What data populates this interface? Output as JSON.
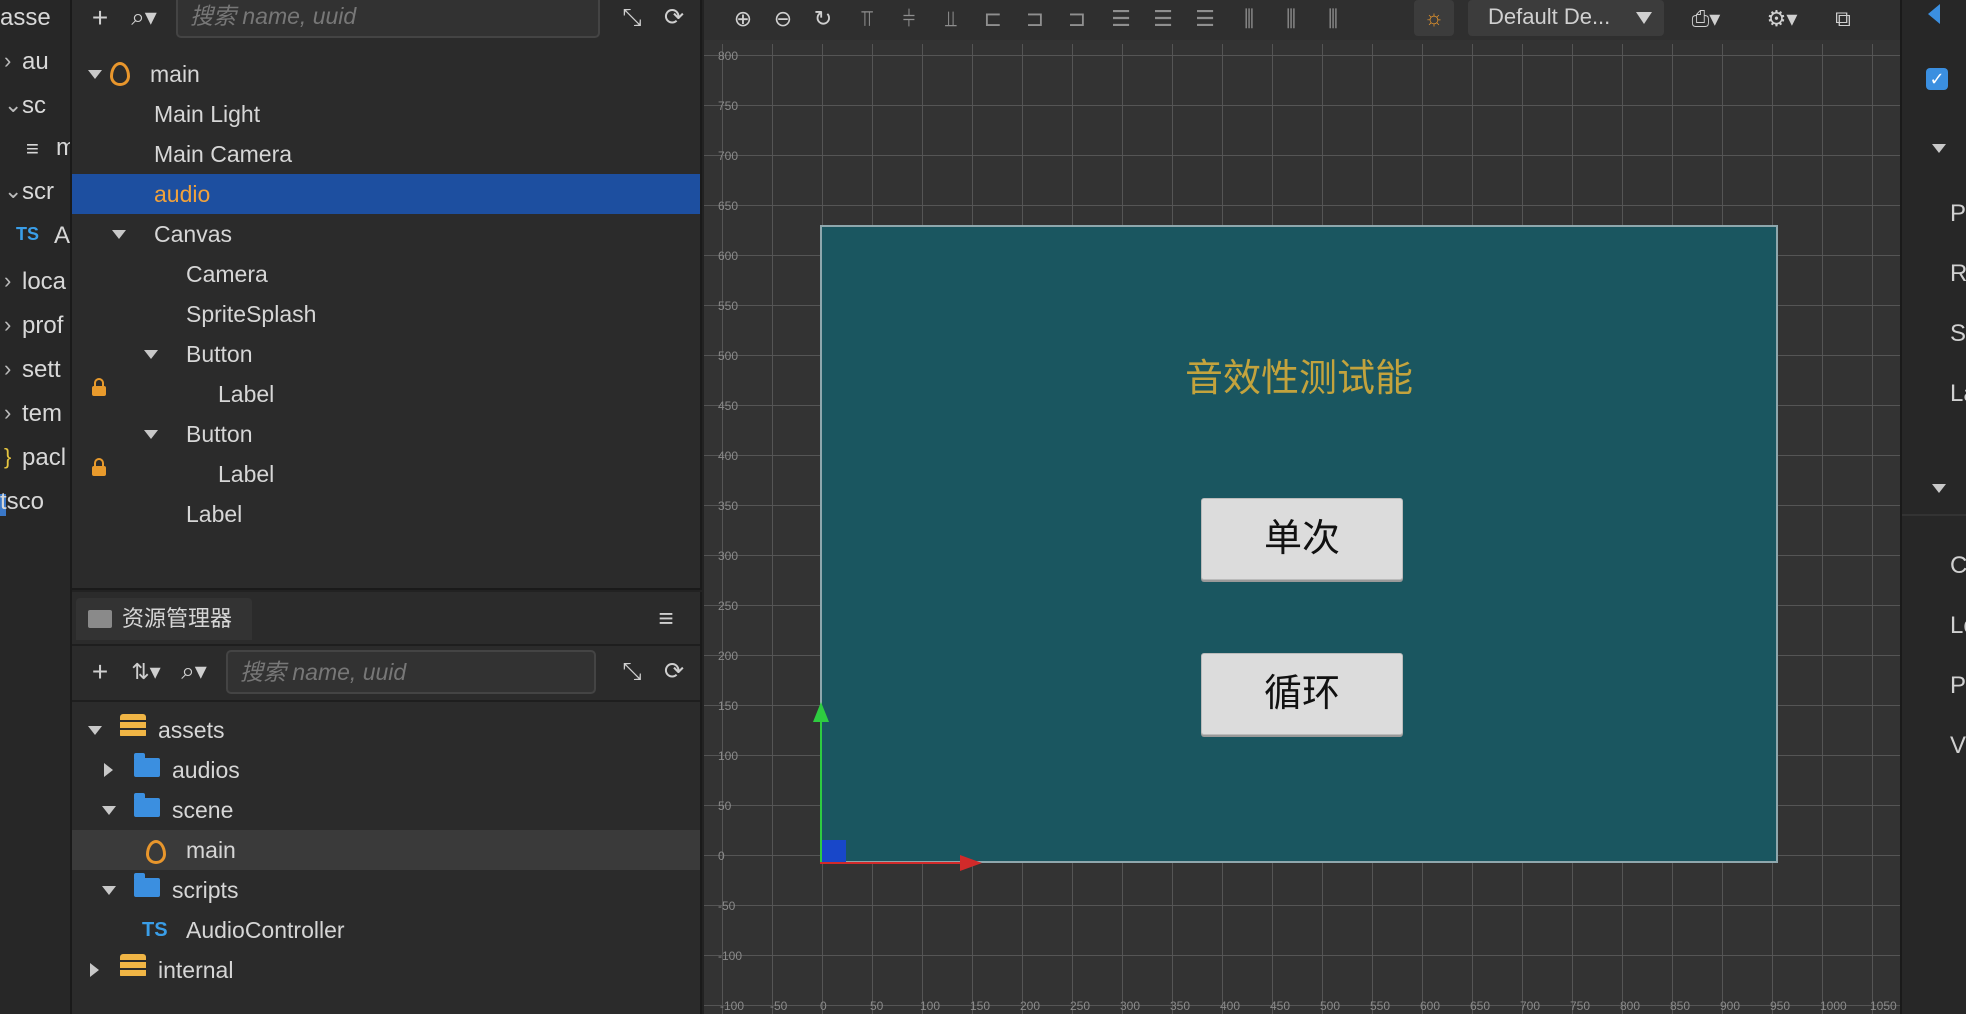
{
  "left_clip": {
    "items": [
      {
        "chev": "",
        "text": "asse"
      },
      {
        "chev": ">",
        "text": "au"
      },
      {
        "chev": "v",
        "text": "sc"
      },
      {
        "chev": "",
        "text": "m",
        "prefix": "≡"
      },
      {
        "chev": "v",
        "text": "scr"
      },
      {
        "chev": "",
        "text": "A",
        "prefix": "TS"
      },
      {
        "chev": ">",
        "text": "loca"
      },
      {
        "chev": ">",
        "text": "prof"
      },
      {
        "chev": ">",
        "text": "sett"
      },
      {
        "chev": ">",
        "text": "tem"
      },
      {
        "chev": "}",
        "text": "pacl"
      },
      {
        "chev": "",
        "text": "tsco"
      }
    ]
  },
  "hierarchy": {
    "search_placeholder": "搜索 name, uuid",
    "nodes": [
      {
        "label": "main",
        "depth": 0,
        "expanded": true,
        "icon": "scene-flame-icon"
      },
      {
        "label": "Main Light",
        "depth": 1
      },
      {
        "label": "Main Camera",
        "depth": 1
      },
      {
        "label": "audio",
        "depth": 1,
        "selected": true
      },
      {
        "label": "Canvas",
        "depth": 1,
        "expanded": true
      },
      {
        "label": "Camera",
        "depth": 2
      },
      {
        "label": "SpriteSplash",
        "depth": 2
      },
      {
        "label": "Button",
        "depth": 2,
        "expanded": true
      },
      {
        "label": "Label",
        "depth": 3,
        "locked": true
      },
      {
        "label": "Button",
        "depth": 2,
        "expanded": true
      },
      {
        "label": "Label",
        "depth": 3,
        "locked": true
      },
      {
        "label": "Label",
        "depth": 2
      }
    ]
  },
  "assets": {
    "tab_title": "资源管理器",
    "search_placeholder": "搜索 name, uuid",
    "items": [
      {
        "label": "assets",
        "depth": 0,
        "state": "expanded",
        "icon": "database-icon"
      },
      {
        "label": "audios",
        "depth": 1,
        "state": "collapsed",
        "icon": "folder-icon"
      },
      {
        "label": "scene",
        "depth": 1,
        "state": "expanded",
        "icon": "folder-icon"
      },
      {
        "label": "main",
        "depth": 2,
        "state": "none",
        "icon": "scene-flame-icon",
        "hover": true
      },
      {
        "label": "scripts",
        "depth": 1,
        "state": "expanded",
        "icon": "folder-icon"
      },
      {
        "label": "AudioController",
        "depth": 2,
        "state": "none",
        "icon": "typescript-icon"
      },
      {
        "label": "internal",
        "depth": 0,
        "state": "collapsed",
        "icon": "database-icon"
      }
    ]
  },
  "scene": {
    "camera_dropdown": "Default De...",
    "ts_badge": "TS",
    "y_ticks": [
      "800",
      "750",
      "700",
      "650",
      "600",
      "550",
      "500",
      "450",
      "400",
      "350",
      "300",
      "250",
      "200",
      "150",
      "100",
      "50",
      "0",
      "-50",
      "-100"
    ],
    "x_ticks": [
      "-100",
      "-50",
      "0",
      "50",
      "100",
      "150",
      "200",
      "250",
      "300",
      "350",
      "400",
      "450",
      "500",
      "550",
      "600",
      "650",
      "700",
      "750",
      "800",
      "850",
      "900",
      "950",
      "1000",
      "1050"
    ],
    "canvas_title": "音效性测试能",
    "button_single": "单次",
    "button_loop": "循环",
    "colors": {
      "canvas_bg": "#1a5660",
      "title": "#c3a33d",
      "selection": "#1d4fa0",
      "accent": "#e8962c"
    }
  },
  "inspector": {
    "items": [
      "Pc",
      "Rc",
      "Sc",
      "La",
      "C",
      "Lc",
      "Pl",
      "Vc"
    ]
  }
}
